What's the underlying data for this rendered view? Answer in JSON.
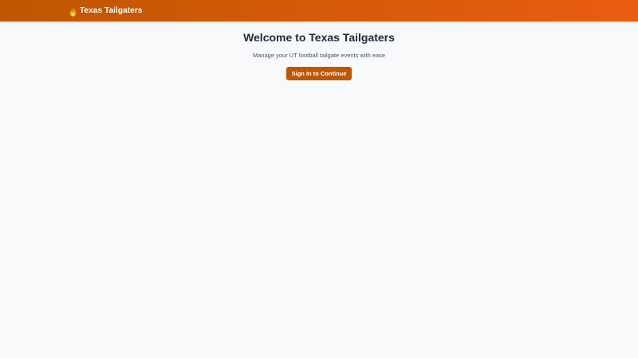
{
  "header": {
    "brand_icon": "flame-icon",
    "brand_label": "Texas Tailgaters",
    "colors": {
      "gradient_start": "#bf5700",
      "gradient_end": "#ea5d10"
    }
  },
  "main": {
    "title": "Welcome to Texas Tailgaters",
    "subtitle": "Manage your UT football tailgate events with ease",
    "signin_label": "Sign In to Continue",
    "colors": {
      "button": "#bf5700",
      "background": "#f8f9fb"
    }
  }
}
